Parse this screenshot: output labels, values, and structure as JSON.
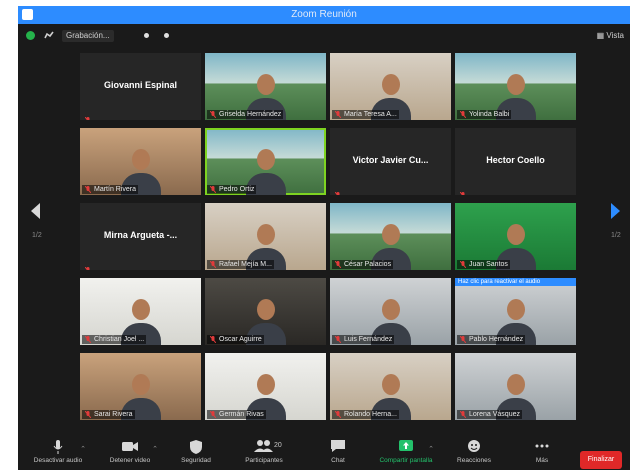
{
  "window": {
    "title": "Zoom Reunión"
  },
  "topbar": {
    "recording_label": "Grabación...",
    "view_label": "Vista"
  },
  "participants": [
    {
      "name": "Giovanni Espinal",
      "video": false
    },
    {
      "name": "Griselda Hernández",
      "video": true,
      "bg": "sky"
    },
    {
      "name": "María Teresa A...",
      "video": true,
      "bg": "room"
    },
    {
      "name": "Yolinda Balbi",
      "video": true,
      "bg": "sky"
    },
    {
      "name": "Martín Rivera",
      "video": true,
      "bg": "warm"
    },
    {
      "name": "Pedro Ortiz",
      "video": true,
      "bg": "sky",
      "speaking": true
    },
    {
      "name": "Victor Javier Cu...",
      "video": false
    },
    {
      "name": "Hector Coello",
      "video": false
    },
    {
      "name": "Mirna Argueta -...",
      "video": false
    },
    {
      "name": "Rafael Mejía M...",
      "video": true,
      "bg": "room"
    },
    {
      "name": "César Palacios",
      "video": true,
      "bg": "sky"
    },
    {
      "name": "Juan Santos",
      "video": true,
      "bg": "green"
    },
    {
      "name": "Christian Joel ...",
      "video": true,
      "bg": "white"
    },
    {
      "name": "Oscar Aguirre",
      "video": true,
      "bg": "dark"
    },
    {
      "name": "Luis Fernández",
      "video": true,
      "bg": "grey"
    },
    {
      "name": "Pablo Hernández",
      "video": true,
      "bg": "grey",
      "banner": "Haz clic para reactivar el audio"
    },
    {
      "name": "Sarai Rivera",
      "video": true,
      "bg": "warm"
    },
    {
      "name": "Germán Rivas",
      "video": true,
      "bg": "white"
    },
    {
      "name": "Rolando Herna...",
      "video": true,
      "bg": "room"
    },
    {
      "name": "Lorena Vásquez",
      "video": true,
      "bg": "grey"
    }
  ],
  "pager": {
    "left_label": "1/2",
    "right_label": "1/2"
  },
  "toolbar": {
    "audio": "Desactivar audio",
    "video": "Detener video",
    "security": "Seguridad",
    "participants": "Participantes",
    "participants_count": "20",
    "chat": "Chat",
    "share": "Compartir pantalla",
    "reactions": "Reacciones",
    "more": "Más",
    "end": "Finalizar"
  }
}
